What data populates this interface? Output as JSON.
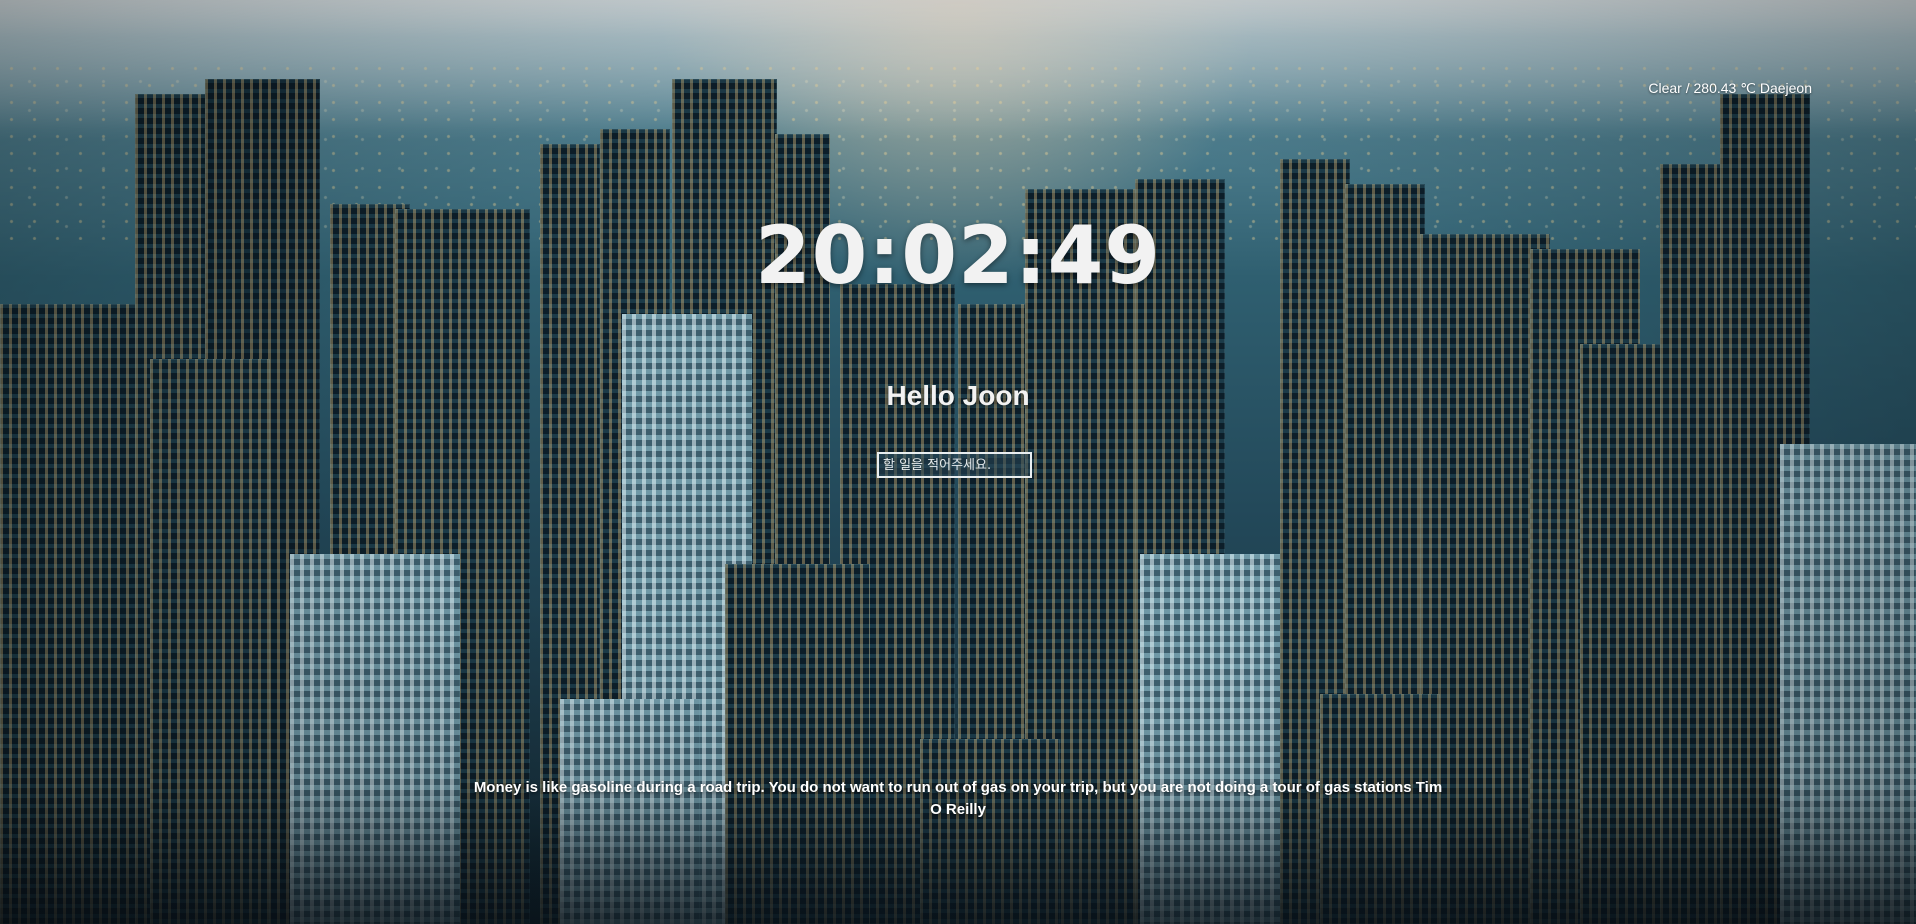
{
  "weather": {
    "text": "Clear / 280.43 ℃ Daejeon"
  },
  "clock": {
    "time": "20:02:49"
  },
  "greeting": {
    "text": "Hello Joon"
  },
  "todo": {
    "placeholder": "할 일을 적어주세요."
  },
  "quote": {
    "text": "Money is like gasoline during a road trip. You do not want to run out of gas on your trip, but you are not doing a tour of gas stations Tim O Reilly"
  }
}
